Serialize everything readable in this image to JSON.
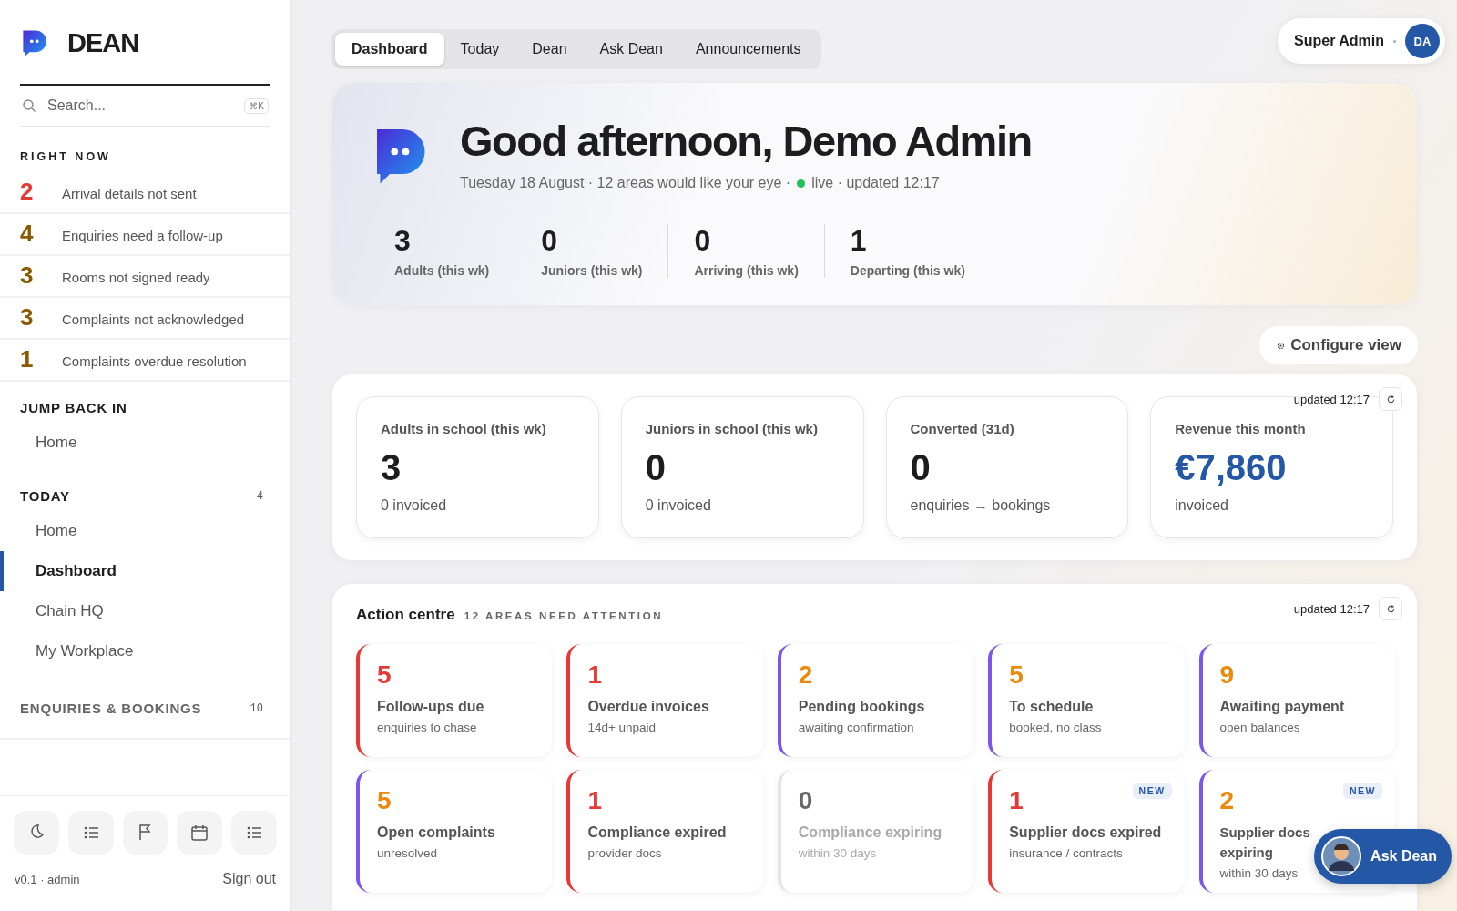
{
  "brand": {
    "name": "DEAN"
  },
  "search": {
    "placeholder": "Search...",
    "shortcut": "⌘K"
  },
  "right_now": {
    "title": "RIGHT NOW",
    "items": [
      {
        "count": "2",
        "label": "Arrival details not sent",
        "color": "#e53935"
      },
      {
        "count": "4",
        "label": "Enquiries need a follow-up",
        "color": "#8a5a00"
      },
      {
        "count": "3",
        "label": "Rooms not signed ready",
        "color": "#8a5a00"
      },
      {
        "count": "3",
        "label": "Complaints not acknowledged",
        "color": "#8a5a00"
      },
      {
        "count": "1",
        "label": "Complaints overdue resolution",
        "color": "#8a5a00"
      }
    ]
  },
  "nav_sections": [
    {
      "title": "JUMP BACK IN",
      "expanded": true,
      "items": [
        {
          "label": "Home",
          "selected": false
        }
      ]
    },
    {
      "title": "TODAY",
      "count": "4",
      "expanded": true,
      "items": [
        {
          "label": "Home",
          "selected": false
        },
        {
          "label": "Dashboard",
          "selected": true
        },
        {
          "label": "Chain HQ",
          "selected": false
        },
        {
          "label": "My Workplace",
          "selected": false
        }
      ]
    },
    {
      "title": "ENQUIRIES & BOOKINGS",
      "count": "10",
      "expanded": false
    }
  ],
  "quick_actions": [
    {
      "kind": "moon"
    },
    {
      "kind": "list"
    },
    {
      "kind": "flag"
    },
    {
      "kind": "calendar"
    },
    {
      "kind": "list"
    }
  ],
  "footer": {
    "version": "v0.1 · admin",
    "sign_out": "Sign out"
  },
  "tabs": [
    {
      "label": "Dashboard",
      "selected": true
    },
    {
      "label": "Today",
      "selected": false
    },
    {
      "label": "Dean",
      "selected": false
    },
    {
      "label": "Ask Dean",
      "selected": false
    },
    {
      "label": "Announcements",
      "selected": false
    }
  ],
  "user": {
    "name": "Super Admin",
    "initials": "DA"
  },
  "hero": {
    "greeting": "Good afternoon, Demo Admin",
    "subtitle": "Tuesday 18 August · 12 areas would like your eye ·",
    "live": true,
    "status": "live · updated 12:17",
    "stats": [
      {
        "value": "3",
        "label": "Adults (this wk)"
      },
      {
        "value": "0",
        "label": "Juniors (this wk)"
      },
      {
        "value": "0",
        "label": "Arriving (this wk)"
      },
      {
        "value": "1",
        "label": "Departing (this wk)"
      }
    ]
  },
  "configure_button": "Configure view",
  "kpis": {
    "updated": "updated 12:17",
    "cards": [
      {
        "label": "Adults in school (this wk)",
        "value": "3",
        "note": "0 invoiced",
        "accent": false
      },
      {
        "label": "Juniors in school (this wk)",
        "value": "0",
        "note": "0 invoiced",
        "accent": false
      },
      {
        "label": "Converted (31d)",
        "value": "0",
        "note": "enquiries → bookings",
        "accent": false
      },
      {
        "label": "Revenue this month",
        "value": "€7,860",
        "note": "invoiced",
        "accent": true
      }
    ]
  },
  "action_centre": {
    "title": "Action centre",
    "subtitle": "12 AREAS NEED ATTENTION",
    "updated": "updated 12:17",
    "cards": [
      {
        "kind": "urgent",
        "count": "5",
        "title": "Follow-ups due",
        "note": "enquiries to chase"
      },
      {
        "kind": "urgent",
        "count": "1",
        "title": "Overdue invoices",
        "note": "14d+ unpaid"
      },
      {
        "kind": "pending",
        "count": "2",
        "title": "Pending bookings",
        "note": "awaiting confirmation"
      },
      {
        "kind": "pending",
        "count": "5",
        "title": "To schedule",
        "note": "booked, no class"
      },
      {
        "kind": "pending",
        "count": "9",
        "title": "Awaiting payment",
        "note": "open balances"
      },
      {
        "kind": "pending",
        "count": "5",
        "title": "Open complaints",
        "note": "unresolved"
      },
      {
        "kind": "urgent",
        "count": "1",
        "title": "Compliance expired",
        "note": "provider docs"
      },
      {
        "kind": "idle",
        "count": "0",
        "title": "Compliance expiring",
        "note": "within 30 days"
      },
      {
        "kind": "urgent",
        "count": "1",
        "title": "Supplier docs expired",
        "note": "insurance / contracts",
        "badge": "NEW"
      },
      {
        "kind": "pending",
        "count": "2",
        "title": "Supplier docs expiring",
        "note": "within 30 days",
        "badge": "NEW"
      }
    ]
  },
  "assistant_button": {
    "label": "Ask Dean"
  }
}
